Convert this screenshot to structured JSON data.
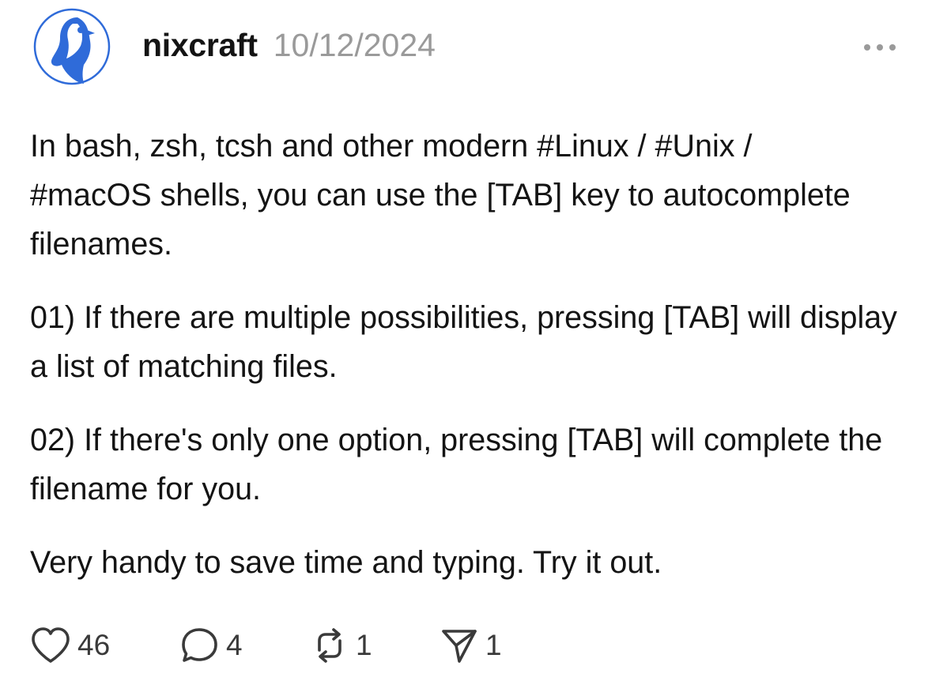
{
  "post": {
    "author": "nixcraft",
    "date": "10/12/2024",
    "avatar_icon": "penguin-logo",
    "more_icon": "more-horizontal-icon",
    "paragraphs": [
      {
        "parts": [
          "In bash, zsh, tcsh and other modern ",
          "#Linux",
          " / ",
          "#Unix",
          " / ",
          "#macOS",
          " shells, you can use the [TAB] key to autocomplete filenames."
        ]
      },
      {
        "text": "01) If there are multiple possibilities, pressing [TAB] will display a list of matching files."
      },
      {
        "text": "02) If there's only one option, pressing [TAB] will complete the filename for you."
      },
      {
        "text": "Very handy to save time and typing. Try it out."
      }
    ]
  },
  "actions": {
    "like": {
      "icon": "heart-icon",
      "count": "46"
    },
    "reply": {
      "icon": "comment-bubble-icon",
      "count": "4"
    },
    "repost": {
      "icon": "repost-icon",
      "count": "1"
    },
    "share": {
      "icon": "send-icon",
      "count": "1"
    }
  },
  "colors": {
    "text": "#141414",
    "muted": "#9a9a9a",
    "avatar_blue": "#2f6bd9"
  }
}
